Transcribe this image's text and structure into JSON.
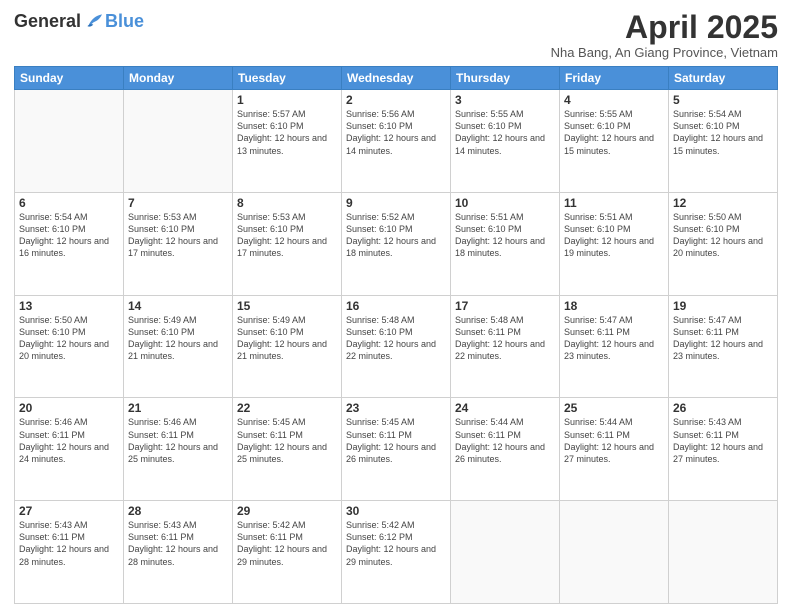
{
  "header": {
    "logo_general": "General",
    "logo_blue": "Blue",
    "month_title": "April 2025",
    "location": "Nha Bang, An Giang Province, Vietnam"
  },
  "days_of_week": [
    "Sunday",
    "Monday",
    "Tuesday",
    "Wednesday",
    "Thursday",
    "Friday",
    "Saturday"
  ],
  "weeks": [
    [
      {
        "day": "",
        "info": ""
      },
      {
        "day": "",
        "info": ""
      },
      {
        "day": "1",
        "info": "Sunrise: 5:57 AM\nSunset: 6:10 PM\nDaylight: 12 hours and 13 minutes."
      },
      {
        "day": "2",
        "info": "Sunrise: 5:56 AM\nSunset: 6:10 PM\nDaylight: 12 hours and 14 minutes."
      },
      {
        "day": "3",
        "info": "Sunrise: 5:55 AM\nSunset: 6:10 PM\nDaylight: 12 hours and 14 minutes."
      },
      {
        "day": "4",
        "info": "Sunrise: 5:55 AM\nSunset: 6:10 PM\nDaylight: 12 hours and 15 minutes."
      },
      {
        "day": "5",
        "info": "Sunrise: 5:54 AM\nSunset: 6:10 PM\nDaylight: 12 hours and 15 minutes."
      }
    ],
    [
      {
        "day": "6",
        "info": "Sunrise: 5:54 AM\nSunset: 6:10 PM\nDaylight: 12 hours and 16 minutes."
      },
      {
        "day": "7",
        "info": "Sunrise: 5:53 AM\nSunset: 6:10 PM\nDaylight: 12 hours and 17 minutes."
      },
      {
        "day": "8",
        "info": "Sunrise: 5:53 AM\nSunset: 6:10 PM\nDaylight: 12 hours and 17 minutes."
      },
      {
        "day": "9",
        "info": "Sunrise: 5:52 AM\nSunset: 6:10 PM\nDaylight: 12 hours and 18 minutes."
      },
      {
        "day": "10",
        "info": "Sunrise: 5:51 AM\nSunset: 6:10 PM\nDaylight: 12 hours and 18 minutes."
      },
      {
        "day": "11",
        "info": "Sunrise: 5:51 AM\nSunset: 6:10 PM\nDaylight: 12 hours and 19 minutes."
      },
      {
        "day": "12",
        "info": "Sunrise: 5:50 AM\nSunset: 6:10 PM\nDaylight: 12 hours and 20 minutes."
      }
    ],
    [
      {
        "day": "13",
        "info": "Sunrise: 5:50 AM\nSunset: 6:10 PM\nDaylight: 12 hours and 20 minutes."
      },
      {
        "day": "14",
        "info": "Sunrise: 5:49 AM\nSunset: 6:10 PM\nDaylight: 12 hours and 21 minutes."
      },
      {
        "day": "15",
        "info": "Sunrise: 5:49 AM\nSunset: 6:10 PM\nDaylight: 12 hours and 21 minutes."
      },
      {
        "day": "16",
        "info": "Sunrise: 5:48 AM\nSunset: 6:10 PM\nDaylight: 12 hours and 22 minutes."
      },
      {
        "day": "17",
        "info": "Sunrise: 5:48 AM\nSunset: 6:11 PM\nDaylight: 12 hours and 22 minutes."
      },
      {
        "day": "18",
        "info": "Sunrise: 5:47 AM\nSunset: 6:11 PM\nDaylight: 12 hours and 23 minutes."
      },
      {
        "day": "19",
        "info": "Sunrise: 5:47 AM\nSunset: 6:11 PM\nDaylight: 12 hours and 23 minutes."
      }
    ],
    [
      {
        "day": "20",
        "info": "Sunrise: 5:46 AM\nSunset: 6:11 PM\nDaylight: 12 hours and 24 minutes."
      },
      {
        "day": "21",
        "info": "Sunrise: 5:46 AM\nSunset: 6:11 PM\nDaylight: 12 hours and 25 minutes."
      },
      {
        "day": "22",
        "info": "Sunrise: 5:45 AM\nSunset: 6:11 PM\nDaylight: 12 hours and 25 minutes."
      },
      {
        "day": "23",
        "info": "Sunrise: 5:45 AM\nSunset: 6:11 PM\nDaylight: 12 hours and 26 minutes."
      },
      {
        "day": "24",
        "info": "Sunrise: 5:44 AM\nSunset: 6:11 PM\nDaylight: 12 hours and 26 minutes."
      },
      {
        "day": "25",
        "info": "Sunrise: 5:44 AM\nSunset: 6:11 PM\nDaylight: 12 hours and 27 minutes."
      },
      {
        "day": "26",
        "info": "Sunrise: 5:43 AM\nSunset: 6:11 PM\nDaylight: 12 hours and 27 minutes."
      }
    ],
    [
      {
        "day": "27",
        "info": "Sunrise: 5:43 AM\nSunset: 6:11 PM\nDaylight: 12 hours and 28 minutes."
      },
      {
        "day": "28",
        "info": "Sunrise: 5:43 AM\nSunset: 6:11 PM\nDaylight: 12 hours and 28 minutes."
      },
      {
        "day": "29",
        "info": "Sunrise: 5:42 AM\nSunset: 6:11 PM\nDaylight: 12 hours and 29 minutes."
      },
      {
        "day": "30",
        "info": "Sunrise: 5:42 AM\nSunset: 6:12 PM\nDaylight: 12 hours and 29 minutes."
      },
      {
        "day": "",
        "info": ""
      },
      {
        "day": "",
        "info": ""
      },
      {
        "day": "",
        "info": ""
      }
    ]
  ]
}
